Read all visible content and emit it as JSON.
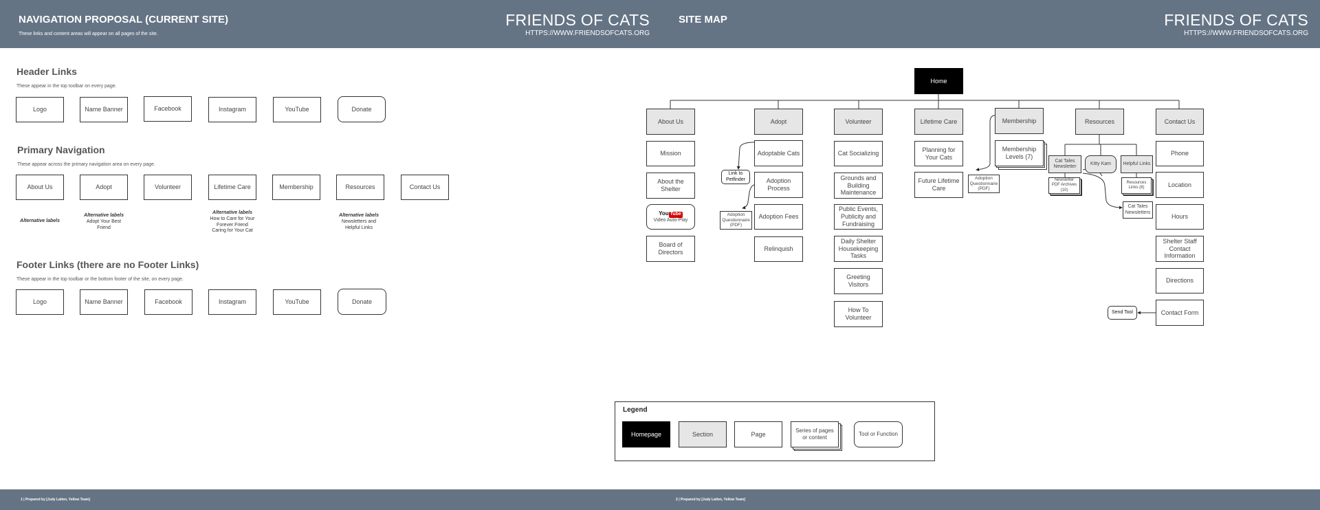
{
  "header": {
    "left_title": "NAVIGATION PROPOSAL (CURRENT SITE)",
    "left_subtitle": "These links and content areas will appear on all pages of the site.",
    "right_title": "SITE MAP",
    "brand": "FRIENDS OF CATS",
    "url": "HTTPS://WWW.FRIENDSOFCATS.ORG"
  },
  "footer": {
    "left": "1 | Prepared by [Judy Latten, Yellow Team]",
    "right": "2 | Prepared by [Judy Latten, Yellow Team]"
  },
  "header_links": {
    "title": "Header Links",
    "desc": "These appear in the top toolbar on every page.",
    "items": [
      "Logo",
      "Name Banner",
      "Facebook",
      "Instagram",
      "YouTube",
      "Donate"
    ]
  },
  "primary_nav": {
    "title": "Primary Navigation",
    "desc": "These appear across the primary navigation area on every page.",
    "items": [
      "About Us",
      "Adopt",
      "Volunteer",
      "Lifetime Care",
      "Membership",
      "Resources",
      "Contact Us"
    ],
    "alt_heading": "Alternative labels",
    "alt_about": "Alternative labels",
    "alt_adopt": [
      "Adopt Your Best",
      "Friend"
    ],
    "alt_lifetime": [
      "How to Care for Your",
      "Forever Friend",
      "Caring for Your Cat"
    ],
    "alt_resources": [
      "Newsletters and",
      "Helpful Links"
    ]
  },
  "footer_links": {
    "title": "Footer Links (there are no Footer Links)",
    "desc": "These appear in the top toolbar or the bottom footer of the site, on every page.",
    "items": [
      "Logo",
      "Name Banner",
      "Facebook",
      "Instagram",
      "YouTube",
      "Donate"
    ]
  },
  "sitemap": {
    "home": "Home",
    "about": {
      "section": "About Us",
      "pages": [
        "Mission",
        "About the Shelter",
        "Board of Directors"
      ],
      "yt_you": "You",
      "yt_tube": "Tube",
      "yt_text": "Video Auto-Play"
    },
    "adopt": {
      "section": "Adopt",
      "pages": [
        "Adoptable Cats",
        "Adoption Process",
        "Adoption Fees",
        "Relinquish"
      ],
      "link_petfinder": "Link to Petfinder",
      "questionnaire": "Adoption Questionnaire (PDF)"
    },
    "volunteer": {
      "section": "Volunteer",
      "pages": [
        "Cat Socializing",
        "Grounds and Building Maintenance",
        "Public Events, Publicity and Fundraising",
        "Daily Shelter Housekeeping Tasks",
        "Greeting Visitors",
        "How To Volunteer"
      ]
    },
    "lifetime": {
      "section": "Lifetime Care",
      "pages": [
        "Planning for Your Cats",
        "Future Lifetime Care"
      ]
    },
    "membership": {
      "section": "Membership",
      "levels": "Membership Levels (7)",
      "questionnaire": "Adoption Questionnaire (PDF)"
    },
    "resources": {
      "section": "Resources",
      "cat_tales": "Cat Tales Newsletter",
      "kitty_kam": "Kitty Kam",
      "helpful_links": "Helpful Links",
      "newsletter_pdf": "Newsletter PDF Archives (10)",
      "resources_links": "Resources Links (8)",
      "cat_tales_2": "Cat Tales Newsletters"
    },
    "contact": {
      "section": "Contact Us",
      "pages": [
        "Phone",
        "Location",
        "Hours",
        "Shelter Staff Contact Information",
        "Directions",
        "Contact Form"
      ],
      "send_tool": "Send Tool"
    }
  },
  "legend": {
    "title": "Legend",
    "homepage": "Homepage",
    "section": "Section",
    "page": "Page",
    "series": "Series of pages or content",
    "tool": "Tool or Function"
  },
  "colors": {
    "banner": "#657485",
    "section_fill": "#e6e6e6",
    "home_fill": "#000000",
    "youtube_red": "#d40000"
  }
}
